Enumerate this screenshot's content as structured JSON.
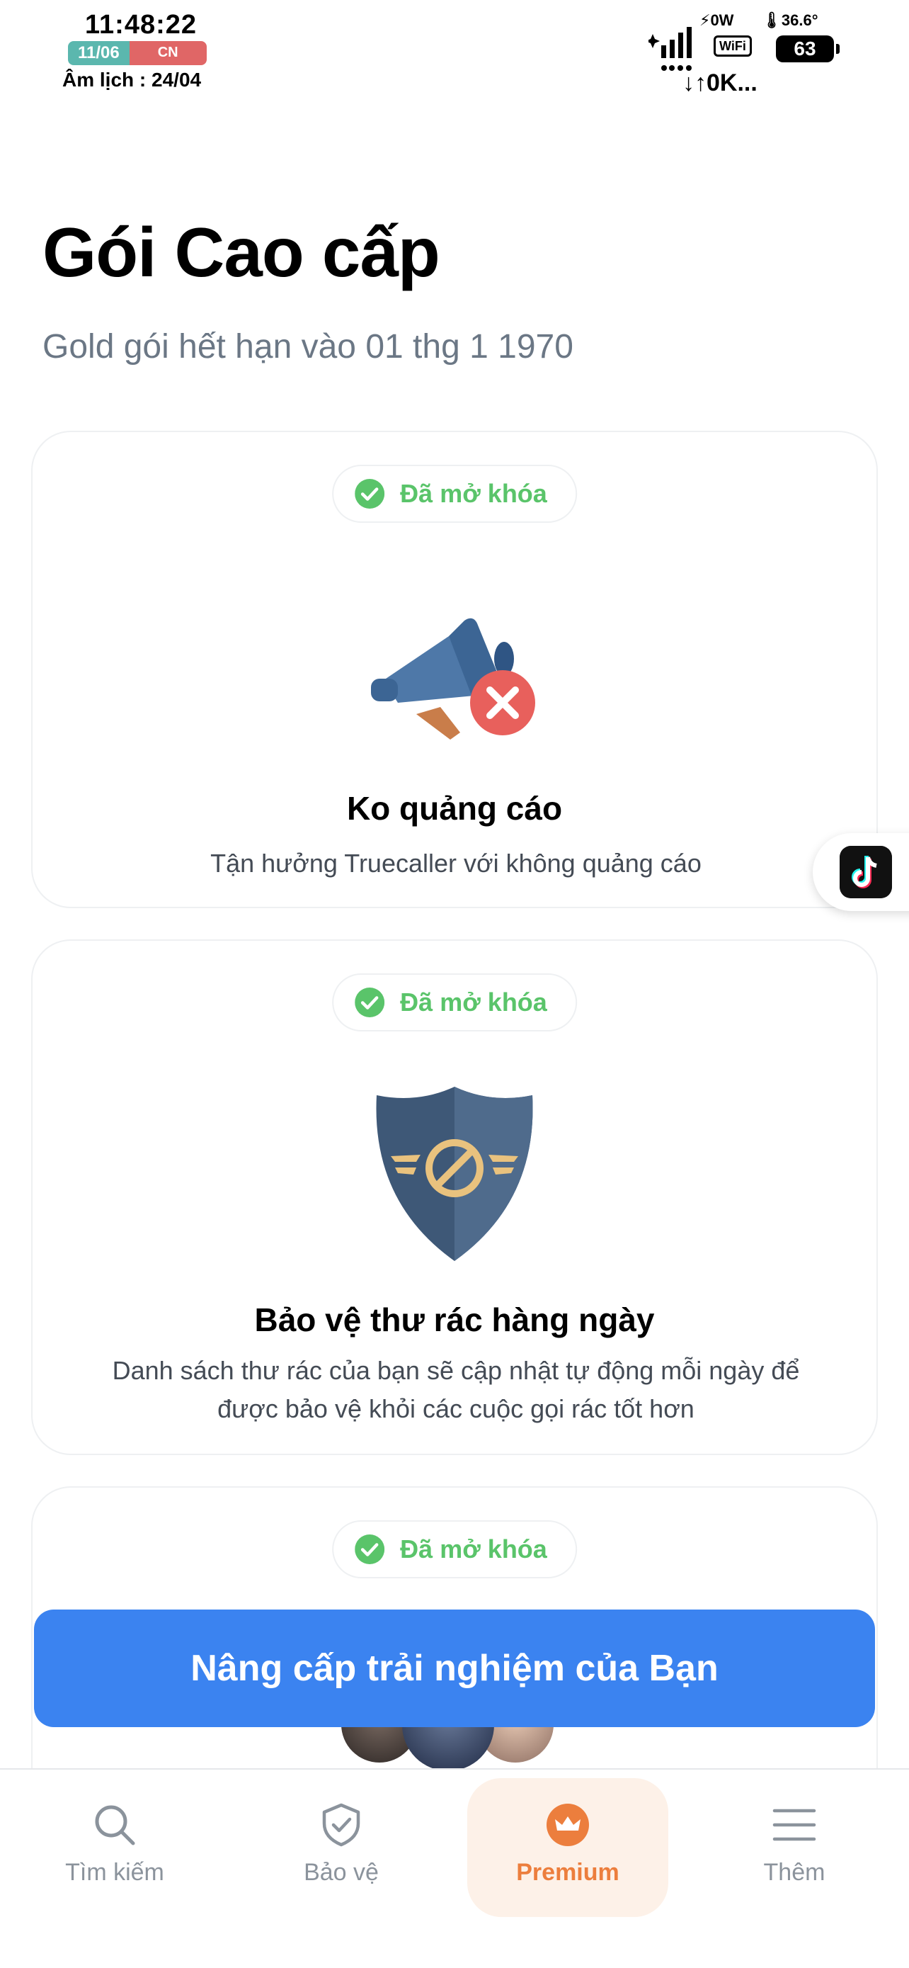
{
  "status_bar": {
    "time": "11:48:22",
    "date": "11/06",
    "weekday": "CN",
    "lunar": "Âm lịch : 24/04",
    "power": "⚡0W",
    "temperature": "🌡36.6°",
    "wifi": "WiFi",
    "battery": "63",
    "speed": "↓↑0K..."
  },
  "header": {
    "title": "Gói Cao cấp",
    "subtitle": "Gold gói hết hạn vào 01 thg 1 1970"
  },
  "features": [
    {
      "badge": "Đã mở khóa",
      "icon": "megaphone-no-ads-icon",
      "title": "Ko quảng cáo",
      "description": "Tận hưởng Truecaller với không quảng cáo"
    },
    {
      "badge": "Đã mở khóa",
      "icon": "spam-shield-icon",
      "title": "Bảo vệ thư rác hàng ngày",
      "description": "Danh sách thư rác của bạn sẽ cập nhật tự động mỗi ngày để được bảo vệ khỏi các cuộc gọi rác tốt hơn"
    },
    {
      "badge": "Đã mở khóa"
    }
  ],
  "cta": {
    "label": "Nâng cấp trải nghiệm của Bạn"
  },
  "tabbar": {
    "items": [
      {
        "label": "Tìm kiếm",
        "icon": "search-icon"
      },
      {
        "label": "Bảo vệ",
        "icon": "shield-check-icon"
      },
      {
        "label": "Premium",
        "icon": "crown-icon",
        "active": true
      },
      {
        "label": "Thêm",
        "icon": "menu-icon"
      }
    ]
  },
  "colors": {
    "accent": "#3b83f0",
    "unlocked_green": "#5ac46a",
    "premium_orange": "#ec7e3d",
    "subtitle_gray": "#6b7785"
  }
}
